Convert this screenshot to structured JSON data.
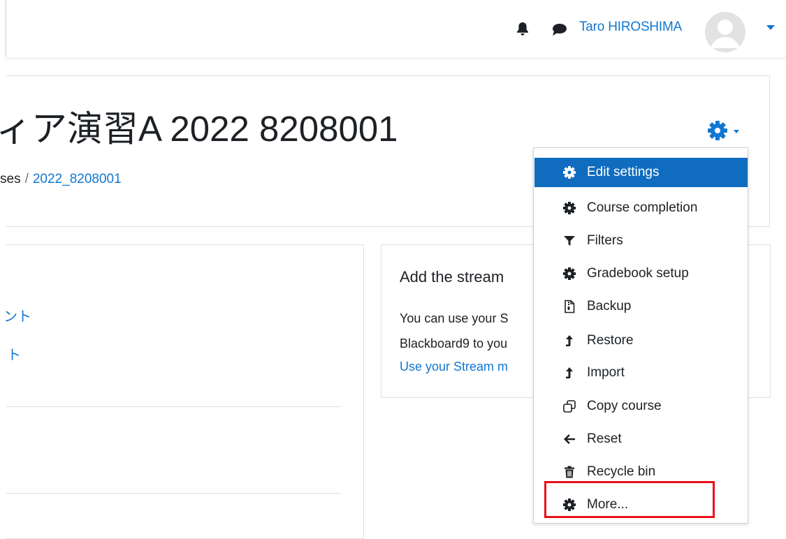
{
  "navbar": {
    "user_name": "Taro HIROSHIMA"
  },
  "course": {
    "title": "ィア演習A 2022 8208001",
    "breadcrumb": {
      "prefix": "ses",
      "separator": "/",
      "current": "2022_8208001"
    }
  },
  "left_panel": {
    "links": [
      "ント",
      "ト"
    ]
  },
  "stream_block": {
    "title": "Add the stream",
    "line1": "You can use your S",
    "line2": "Blackboard9 to you",
    "link": "Use your Stream m"
  },
  "course_menu": {
    "items": [
      {
        "label": "Edit settings",
        "icon": "gear-icon"
      },
      {
        "label": "Course completion",
        "icon": "gear-icon"
      },
      {
        "label": "Filters",
        "icon": "filter-icon"
      },
      {
        "label": "Gradebook setup",
        "icon": "gear-icon"
      },
      {
        "label": "Backup",
        "icon": "file-archive-icon"
      },
      {
        "label": "Restore",
        "icon": "level-up-icon"
      },
      {
        "label": "Import",
        "icon": "level-up-icon"
      },
      {
        "label": "Copy course",
        "icon": "copy-icon"
      },
      {
        "label": "Reset",
        "icon": "arrow-left-icon"
      },
      {
        "label": "Recycle bin",
        "icon": "trash-icon"
      },
      {
        "label": "More...",
        "icon": "gear-icon"
      }
    ],
    "active_index": 0,
    "highlighted_item": "More..."
  },
  "colors": {
    "link": "#1177d1",
    "active_bg": "#0f6cbf",
    "highlight": "#e8101a"
  }
}
